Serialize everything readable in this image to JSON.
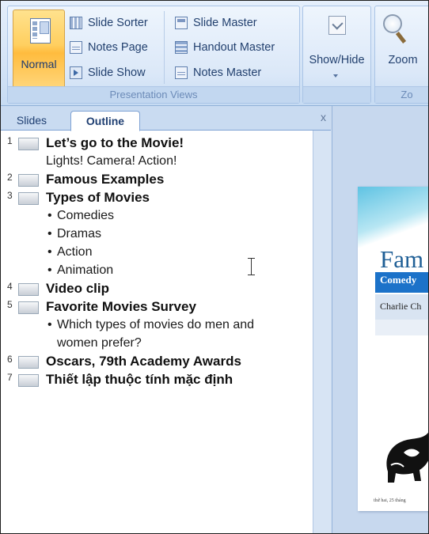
{
  "ribbon": {
    "presentation_views": {
      "group_label": "Presentation Views",
      "normal_label": "Normal",
      "slide_sorter": "Slide Sorter",
      "notes_page": "Notes Page",
      "slide_show": "Slide Show",
      "slide_master": "Slide Master",
      "handout_master": "Handout Master",
      "notes_master": "Notes Master"
    },
    "show_hide_label": "Show/Hide",
    "zoom_label": "Zoom",
    "zoom_group_label": "Zo"
  },
  "pane": {
    "tabs": {
      "slides": "Slides",
      "outline": "Outline",
      "close": "x"
    },
    "slides": [
      {
        "number": "1",
        "title": "Let’s go to the Movie!",
        "body": [
          "Lights! Camera! Action!"
        ]
      },
      {
        "number": "2",
        "title": "Famous Examples"
      },
      {
        "number": "3",
        "title": "Types of Movies",
        "bullets": [
          "Comedies",
          "Dramas",
          "Action",
          "Animation"
        ]
      },
      {
        "number": "4",
        "title": "Video clip"
      },
      {
        "number": "5",
        "title": "Favorite Movies Survey",
        "bullets": [
          "Which types of movies do men and",
          "women prefer?"
        ]
      },
      {
        "number": "6",
        "title": "Oscars, 79th Academy Awards"
      },
      {
        "number": "7",
        "title": "Thiết lập thuộc tính mặc định"
      }
    ]
  },
  "slide_preview": {
    "title": "Fam",
    "table_header": "Comedy",
    "table_cell": "Charlie Ch",
    "date_footer": "thứ hai, 25 tháng"
  },
  "colors": {
    "accent_orange": "#ffc34a",
    "ribbon_blue": "#d6e5f7",
    "table_blue": "#1c72c9"
  }
}
